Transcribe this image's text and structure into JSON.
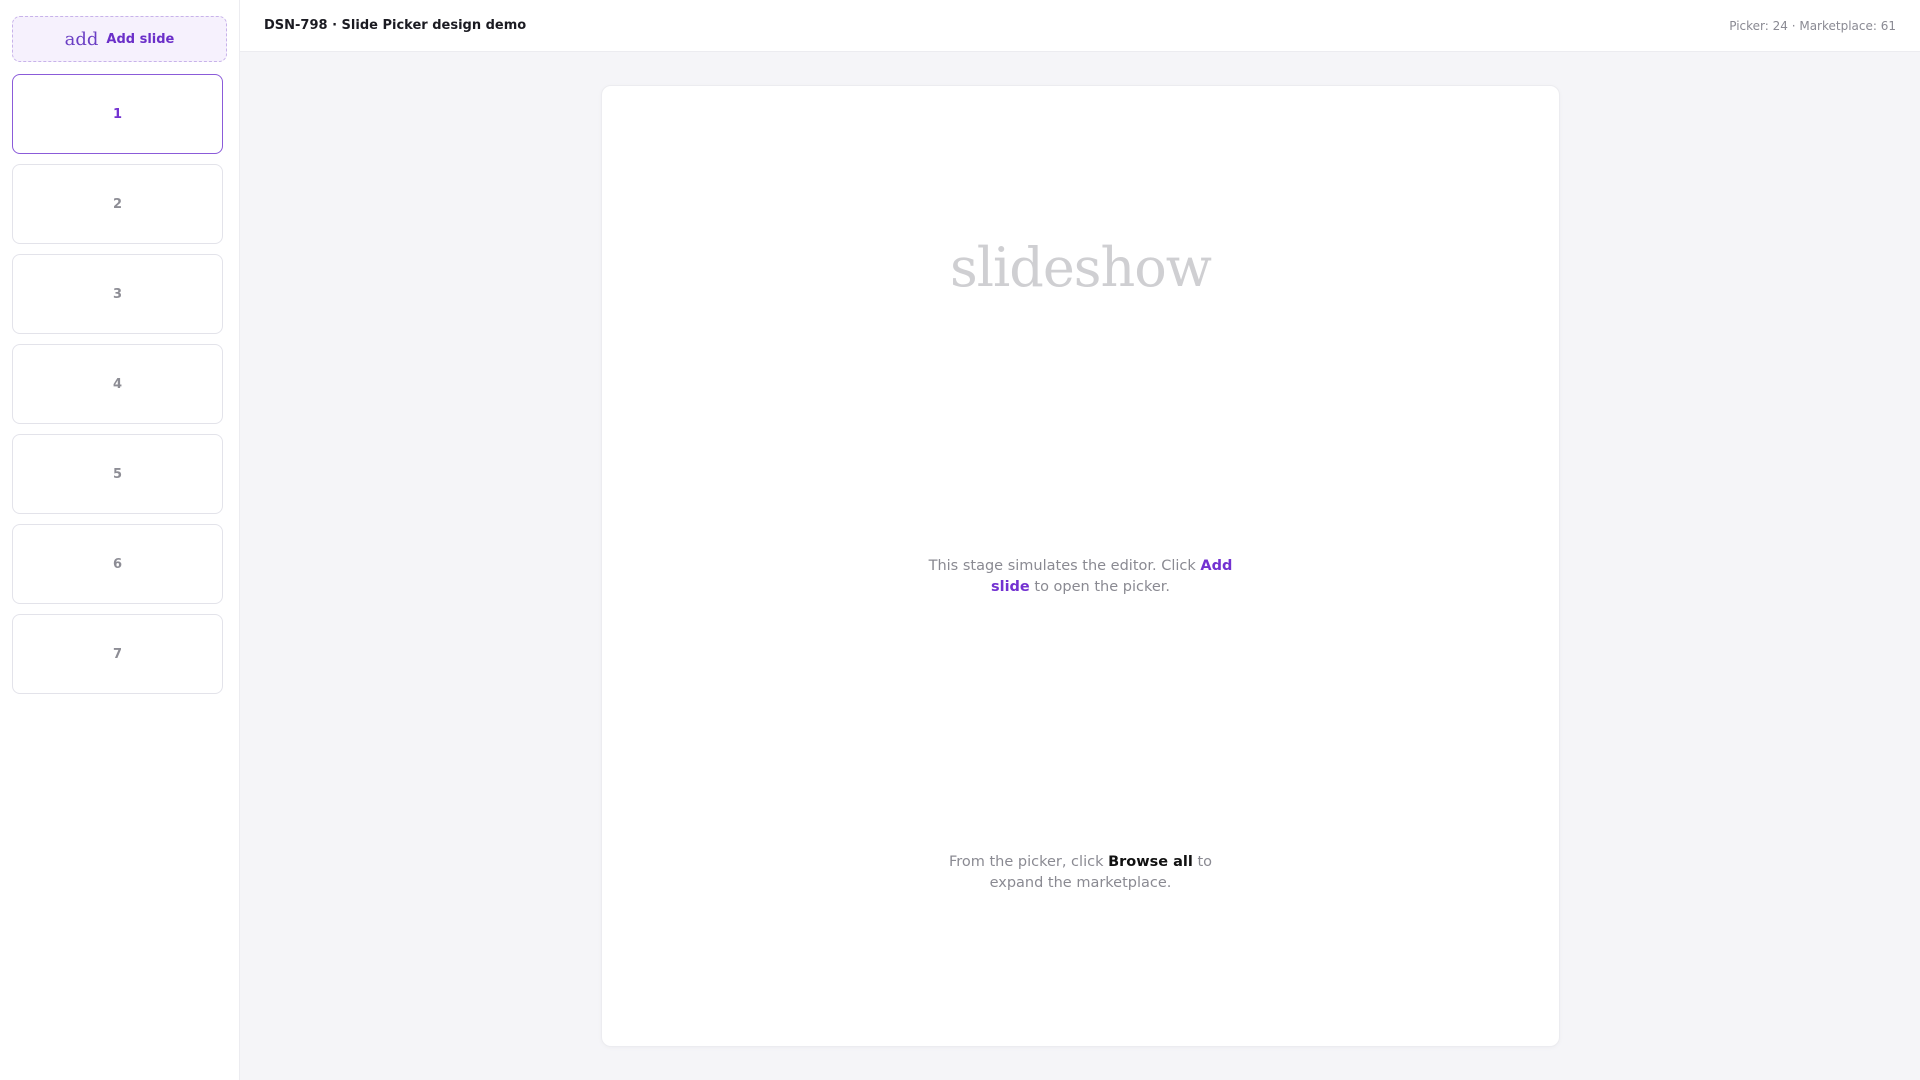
{
  "header": {
    "title": "DSN-798 · Slide Picker design demo",
    "stats": "Picker: 24 · Marketplace: 61"
  },
  "sidebar": {
    "add_icon": "add",
    "add_label": "Add slide",
    "slides": [
      "1",
      "2",
      "3",
      "4",
      "5",
      "6",
      "7"
    ],
    "active_index": 0
  },
  "stage": {
    "wordmark": "slideshow",
    "hint1": {
      "prefix": "This stage simulates the editor. Click ",
      "link": "Add slide",
      "suffix": " to open the picker."
    },
    "hint2": {
      "prefix": "From the picker, click ",
      "link": "Browse all",
      "suffix": " to expand the marketplace."
    }
  },
  "colors": {
    "accent": "#7332d1",
    "accent_bg": "#f6f1fd",
    "border": "#e3e3ea"
  }
}
